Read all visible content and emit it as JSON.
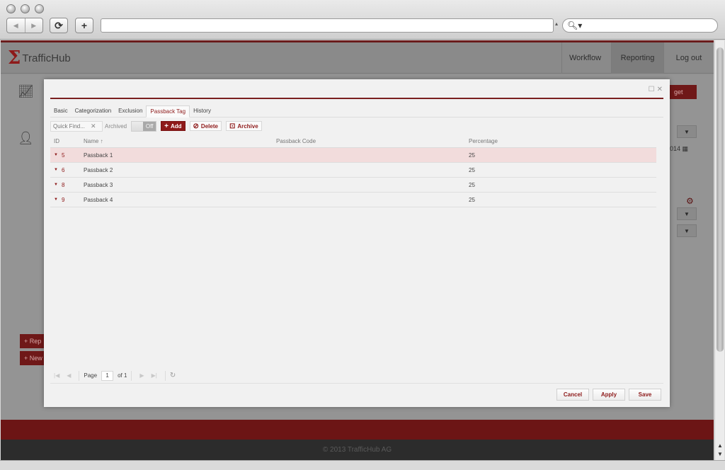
{
  "browser": {
    "back_glyph": "◀",
    "forward_glyph": "▶",
    "reload_glyph": "⟳",
    "new_tab_glyph": "+",
    "search_glyph": "🔍︎▾"
  },
  "app": {
    "logo_text": "TrafficHub",
    "nav": [
      {
        "label": "Workflow"
      },
      {
        "label": "Reporting"
      },
      {
        "label": "Log out"
      }
    ],
    "footer": "© 2013 TrafficHub AG",
    "bg_date_fragment": "014",
    "bg_button_1": "Rep",
    "bg_button_2": "New",
    "bg_target_button": "get"
  },
  "modal": {
    "tabs": [
      {
        "label": "Basic"
      },
      {
        "label": "Categorization"
      },
      {
        "label": "Exclusion"
      },
      {
        "label": "Passback Tag"
      },
      {
        "label": "History"
      }
    ],
    "active_tab": "Passback Tag",
    "toolbar": {
      "quick_find_placeholder": "Quick Find...",
      "archived_label": "Archived",
      "toggle_state": "Off",
      "add_label": "Add",
      "delete_label": "Delete",
      "archive_label": "Archive"
    },
    "grid": {
      "columns": {
        "id": "ID",
        "name": "Name ↑",
        "code": "Passback Code",
        "percentage": "Percentage"
      },
      "rows": [
        {
          "id": "5",
          "name": "Passback 1",
          "code": "",
          "percentage": "25"
        },
        {
          "id": "6",
          "name": "Passback 2",
          "code": "",
          "percentage": "25"
        },
        {
          "id": "8",
          "name": "Passback 3",
          "code": "",
          "percentage": "25"
        },
        {
          "id": "9",
          "name": "Passback 4",
          "code": "",
          "percentage": "25"
        }
      ],
      "selected_row": 0
    },
    "pager": {
      "page_label": "Page",
      "page_value": "1",
      "of_label": "of 1"
    },
    "footer": {
      "cancel": "Cancel",
      "apply": "Apply",
      "save": "Save"
    }
  },
  "colors": {
    "accent": "#8e1a1a",
    "selected_row": "#f2dcdc"
  }
}
